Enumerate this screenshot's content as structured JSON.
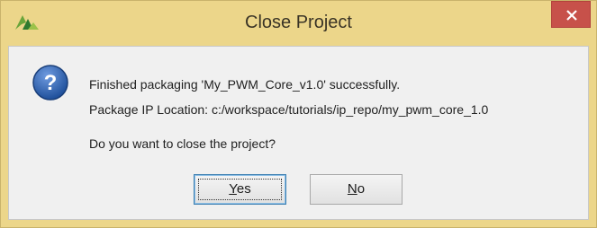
{
  "window": {
    "title": "Close Project",
    "app_icon": "vivado-logo-icon",
    "close_icon": "close-icon"
  },
  "dialog": {
    "icon": "question-icon",
    "line1": "Finished packaging 'My_PWM_Core_v1.0' successfully.",
    "line2": "Package IP Location: c:/workspace/tutorials/ip_repo/my_pwm_core_1.0",
    "question": "Do you want to close the project?"
  },
  "buttons": {
    "yes": {
      "mnemonic": "Y",
      "rest": "es"
    },
    "no": {
      "mnemonic": "N",
      "rest": "o"
    }
  },
  "colors": {
    "titlebar": "#ecd68a",
    "close_button": "#c7514a",
    "content_bg": "#f0f0f0",
    "question_icon": "#2f5fa8"
  }
}
